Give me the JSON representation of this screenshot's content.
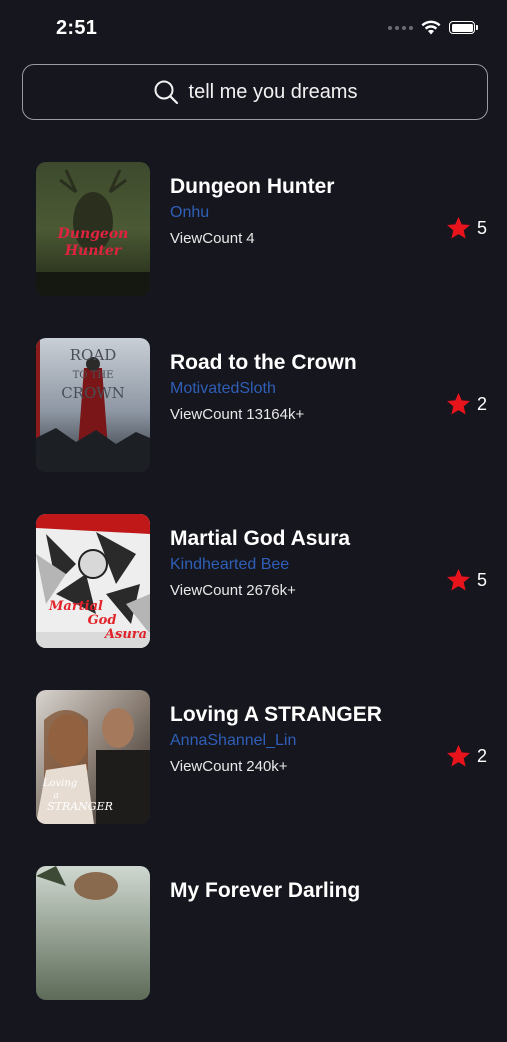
{
  "status_bar": {
    "time": "2:51"
  },
  "search": {
    "text": "tell me you dreams",
    "icon": "search-icon"
  },
  "colors": {
    "background": "#16161e",
    "author": "#2f5fb8",
    "star": "#e8141c"
  },
  "books": [
    {
      "title": "Dungeon Hunter",
      "author": "Onhu",
      "view_label": "ViewCount",
      "view_count": "4",
      "rating": "5",
      "cover_text": [
        "Dungeon",
        "Hunter"
      ]
    },
    {
      "title": "Road to the Crown",
      "author": "MotivatedSloth",
      "view_label": "ViewCount",
      "view_count": "13164k+",
      "rating": "2",
      "cover_text": [
        "ROAD",
        "TO THE",
        "CROWN"
      ]
    },
    {
      "title": "Martial God Asura",
      "author": "Kindhearted Bee",
      "view_label": "ViewCount",
      "view_count": "2676k+",
      "rating": "5",
      "cover_text": [
        "Martial",
        "God",
        "Asura"
      ]
    },
    {
      "title": "Loving A STRANGER",
      "author": "AnnaShannel_Lin",
      "view_label": "ViewCount",
      "view_count": "240k+",
      "rating": "2",
      "cover_text": [
        "Loving",
        "a",
        "STRANGER"
      ]
    },
    {
      "title": "My Forever Darling"
    }
  ]
}
